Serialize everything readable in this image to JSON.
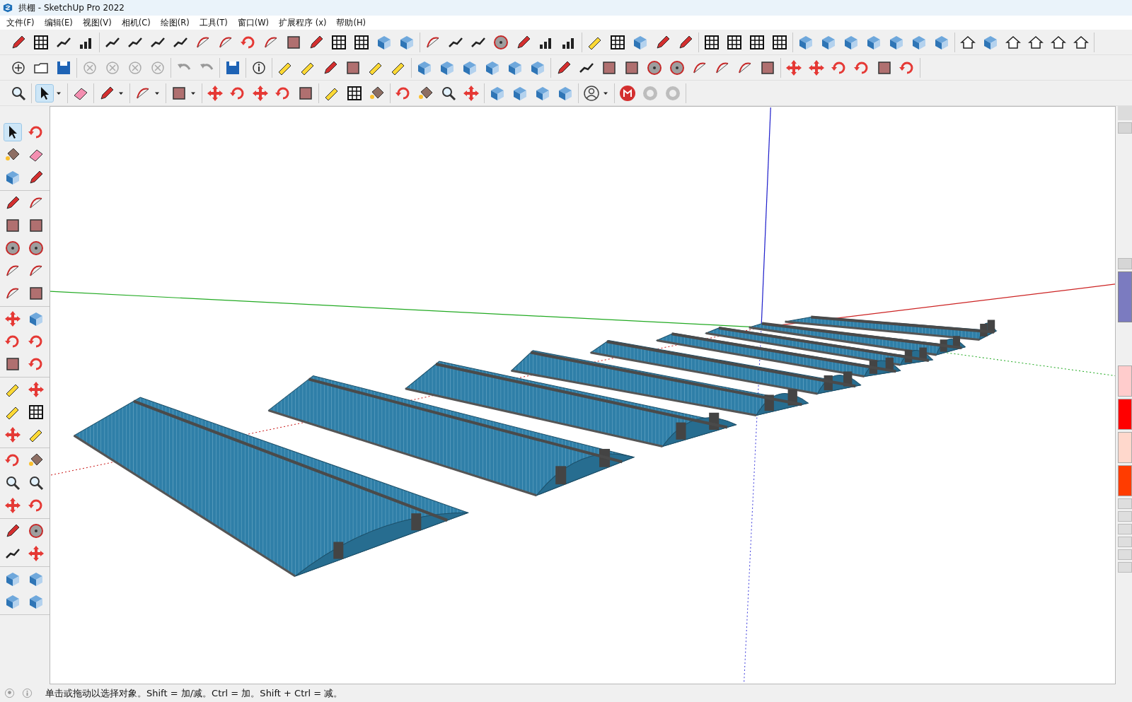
{
  "window": {
    "title": "拱棚 - SketchUp Pro 2022"
  },
  "menu": [
    "文件(F)",
    "编辑(E)",
    "视图(V)",
    "相机(C)",
    "绘图(R)",
    "工具(T)",
    "窗口(W)",
    "扩展程序 (x)",
    "帮助(H)"
  ],
  "active_tool": {
    "kind": "select"
  },
  "right_panel": {
    "swatches": [
      {
        "color": "#ffcccc"
      },
      {
        "color": "#ff0000"
      },
      {
        "color": "#ffd8cc"
      },
      {
        "color": "#ff3c00"
      }
    ]
  },
  "status_bar": {
    "text": "单击或拖动以选择对象。Shift = 加/减。Ctrl = 加。Shift + Ctrl = 减。"
  }
}
